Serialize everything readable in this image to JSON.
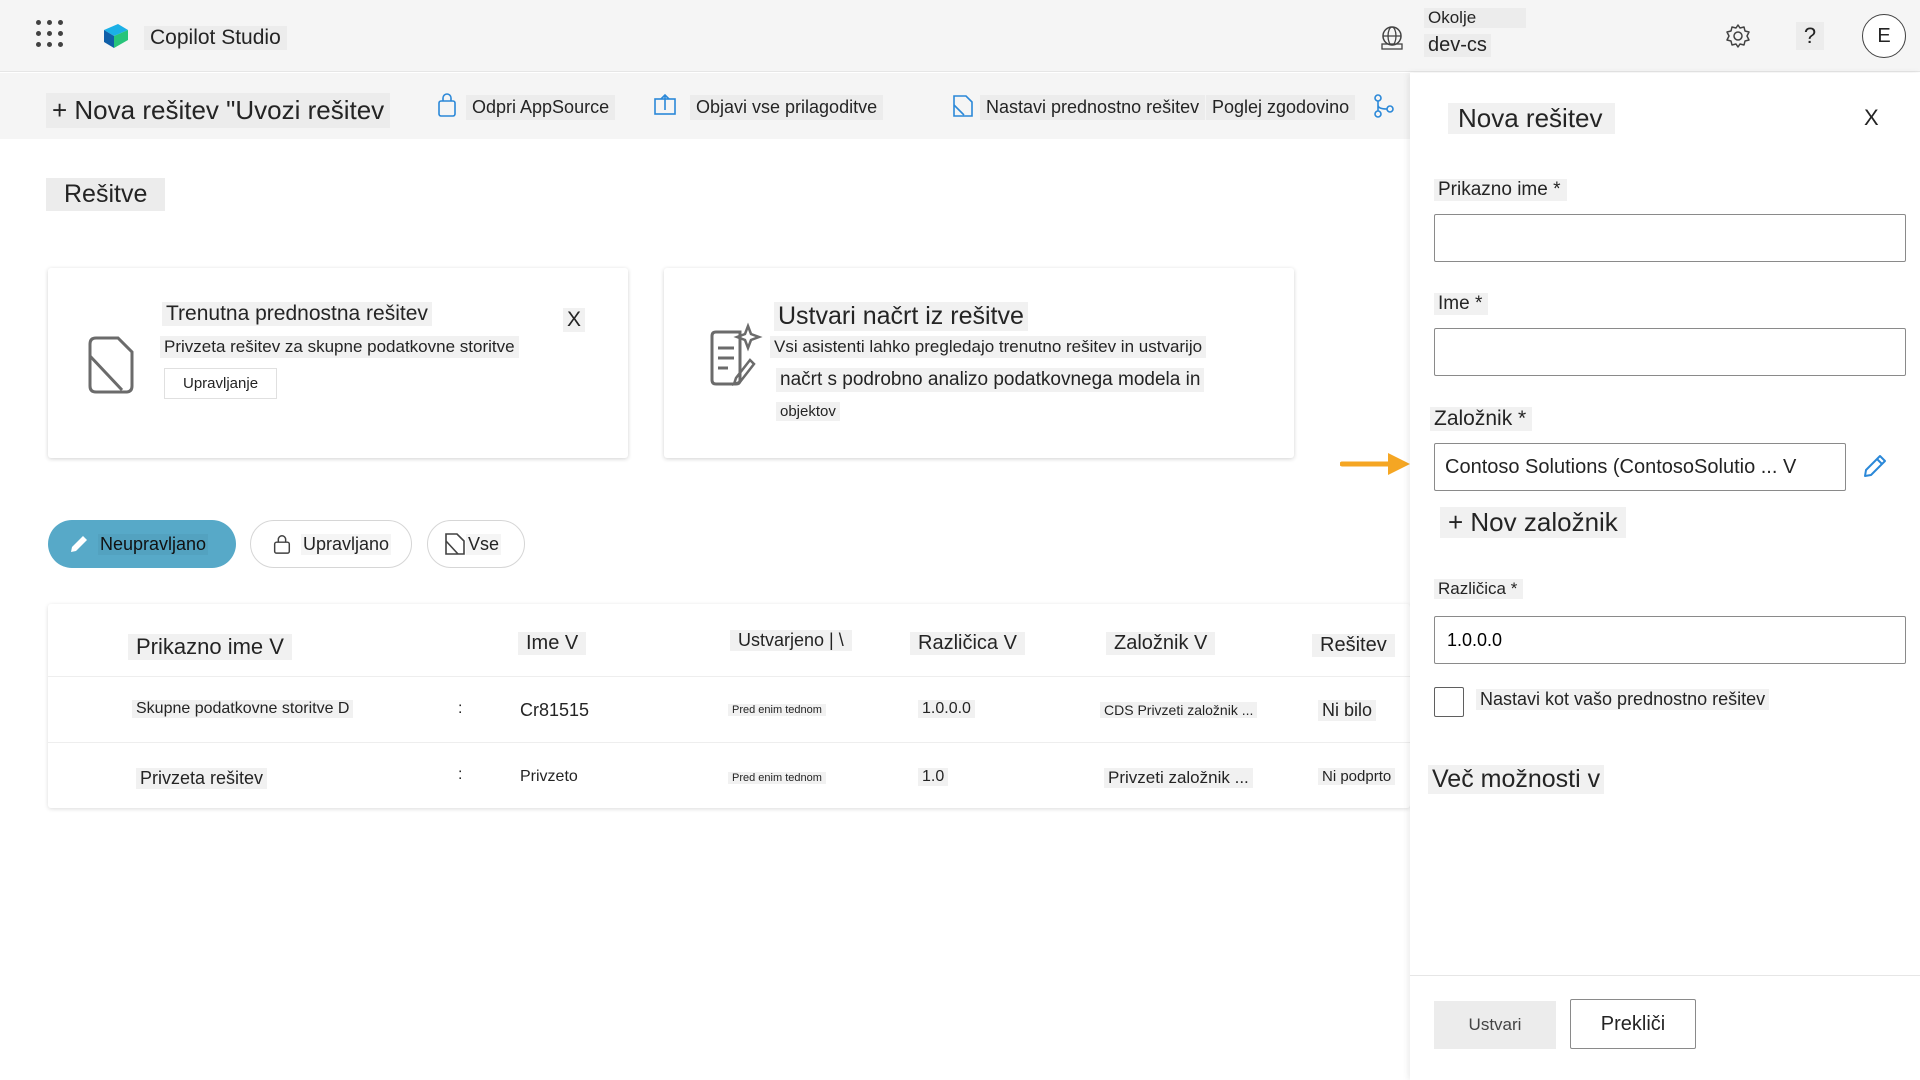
{
  "header": {
    "app_title": "Copilot Studio",
    "env_label": "Okolje",
    "env_name": "dev-cs",
    "help_label": "?",
    "avatar_initial": "E"
  },
  "toolbar": {
    "new_solution": "+ Nova rešitev \"Uvozi rešitev",
    "open_appsource": "Odpri AppSource",
    "publish_all": "Objavi vse prilagoditve",
    "set_preferred": "Nastavi prednostno rešitev",
    "view_history": "Poglej zgodovino"
  },
  "page": {
    "section_title": "Rešitve"
  },
  "cards": {
    "preferred": {
      "title": "Trenutna prednostna rešitev",
      "text": "Privzeta rešitev za skupne podatkovne storitve",
      "button": "Upravljanje",
      "close": "X"
    },
    "draft": {
      "title": "Ustvari načrt iz rešitve",
      "line1": "Vsi asistenti lahko pregledajo trenutno rešitev in ustvarijo",
      "line2": "načrt s podrobno analizo podatkovnega modela in",
      "line3": "objektov"
    }
  },
  "filters": {
    "unmanaged": "Neupravljano",
    "managed": "Upravljano",
    "all": "Vse"
  },
  "table": {
    "headers": {
      "display_name": "Prikazno ime V",
      "name": "Ime V",
      "created": "Ustvarjeno | \\",
      "version": "Različica V",
      "publisher": "Založnik V",
      "solution": "Rešitev"
    },
    "rows": [
      {
        "display_name": "Skupne podatkovne storitve D",
        "more": ":",
        "name": "Cr81515",
        "created": "Pred enim tednom",
        "version": "1.0.0.0",
        "publisher": "CDS Privzeti založnik ...",
        "status": "Ni bilo"
      },
      {
        "display_name": "Privzeta rešitev",
        "more": ":",
        "name": "Privzeto",
        "created": "Pred enim tednom",
        "version": "1.0",
        "publisher": "Privzeti založnik ...",
        "status": "Ni podprto"
      }
    ]
  },
  "panel": {
    "title": "Nova rešitev",
    "close": "X",
    "display_name_label": "Prikazno ime *",
    "display_name_value": "",
    "name_label": "Ime *",
    "name_value": "",
    "publisher_label": "Založnik *",
    "publisher_value": "Contoso Solutions (ContosoSolutio ... V",
    "new_publisher": "+ Nov založnik",
    "version_label": "Različica *",
    "version_value": "1.0.0.0",
    "set_preferred_label": "Nastavi kot vašo prednostno rešitev",
    "more_options": "Več možnosti v",
    "create_button": "Ustvari",
    "cancel_button": "Prekliči"
  },
  "colors": {
    "accent_pill": "#57a9c8",
    "arrow": "#f5a623",
    "pencil": "#2b88d8"
  },
  "icons": [
    "app-launcher-icon",
    "copilot-studio-logo-icon",
    "globe-environment-icon",
    "settings-gear-icon",
    "help-icon",
    "appsource-bag-icon",
    "publish-icon",
    "preferred-solution-icon",
    "history-icon",
    "document-icon",
    "plan-sparkle-icon",
    "pencil-icon",
    "lock-icon",
    "arrow-icon"
  ]
}
